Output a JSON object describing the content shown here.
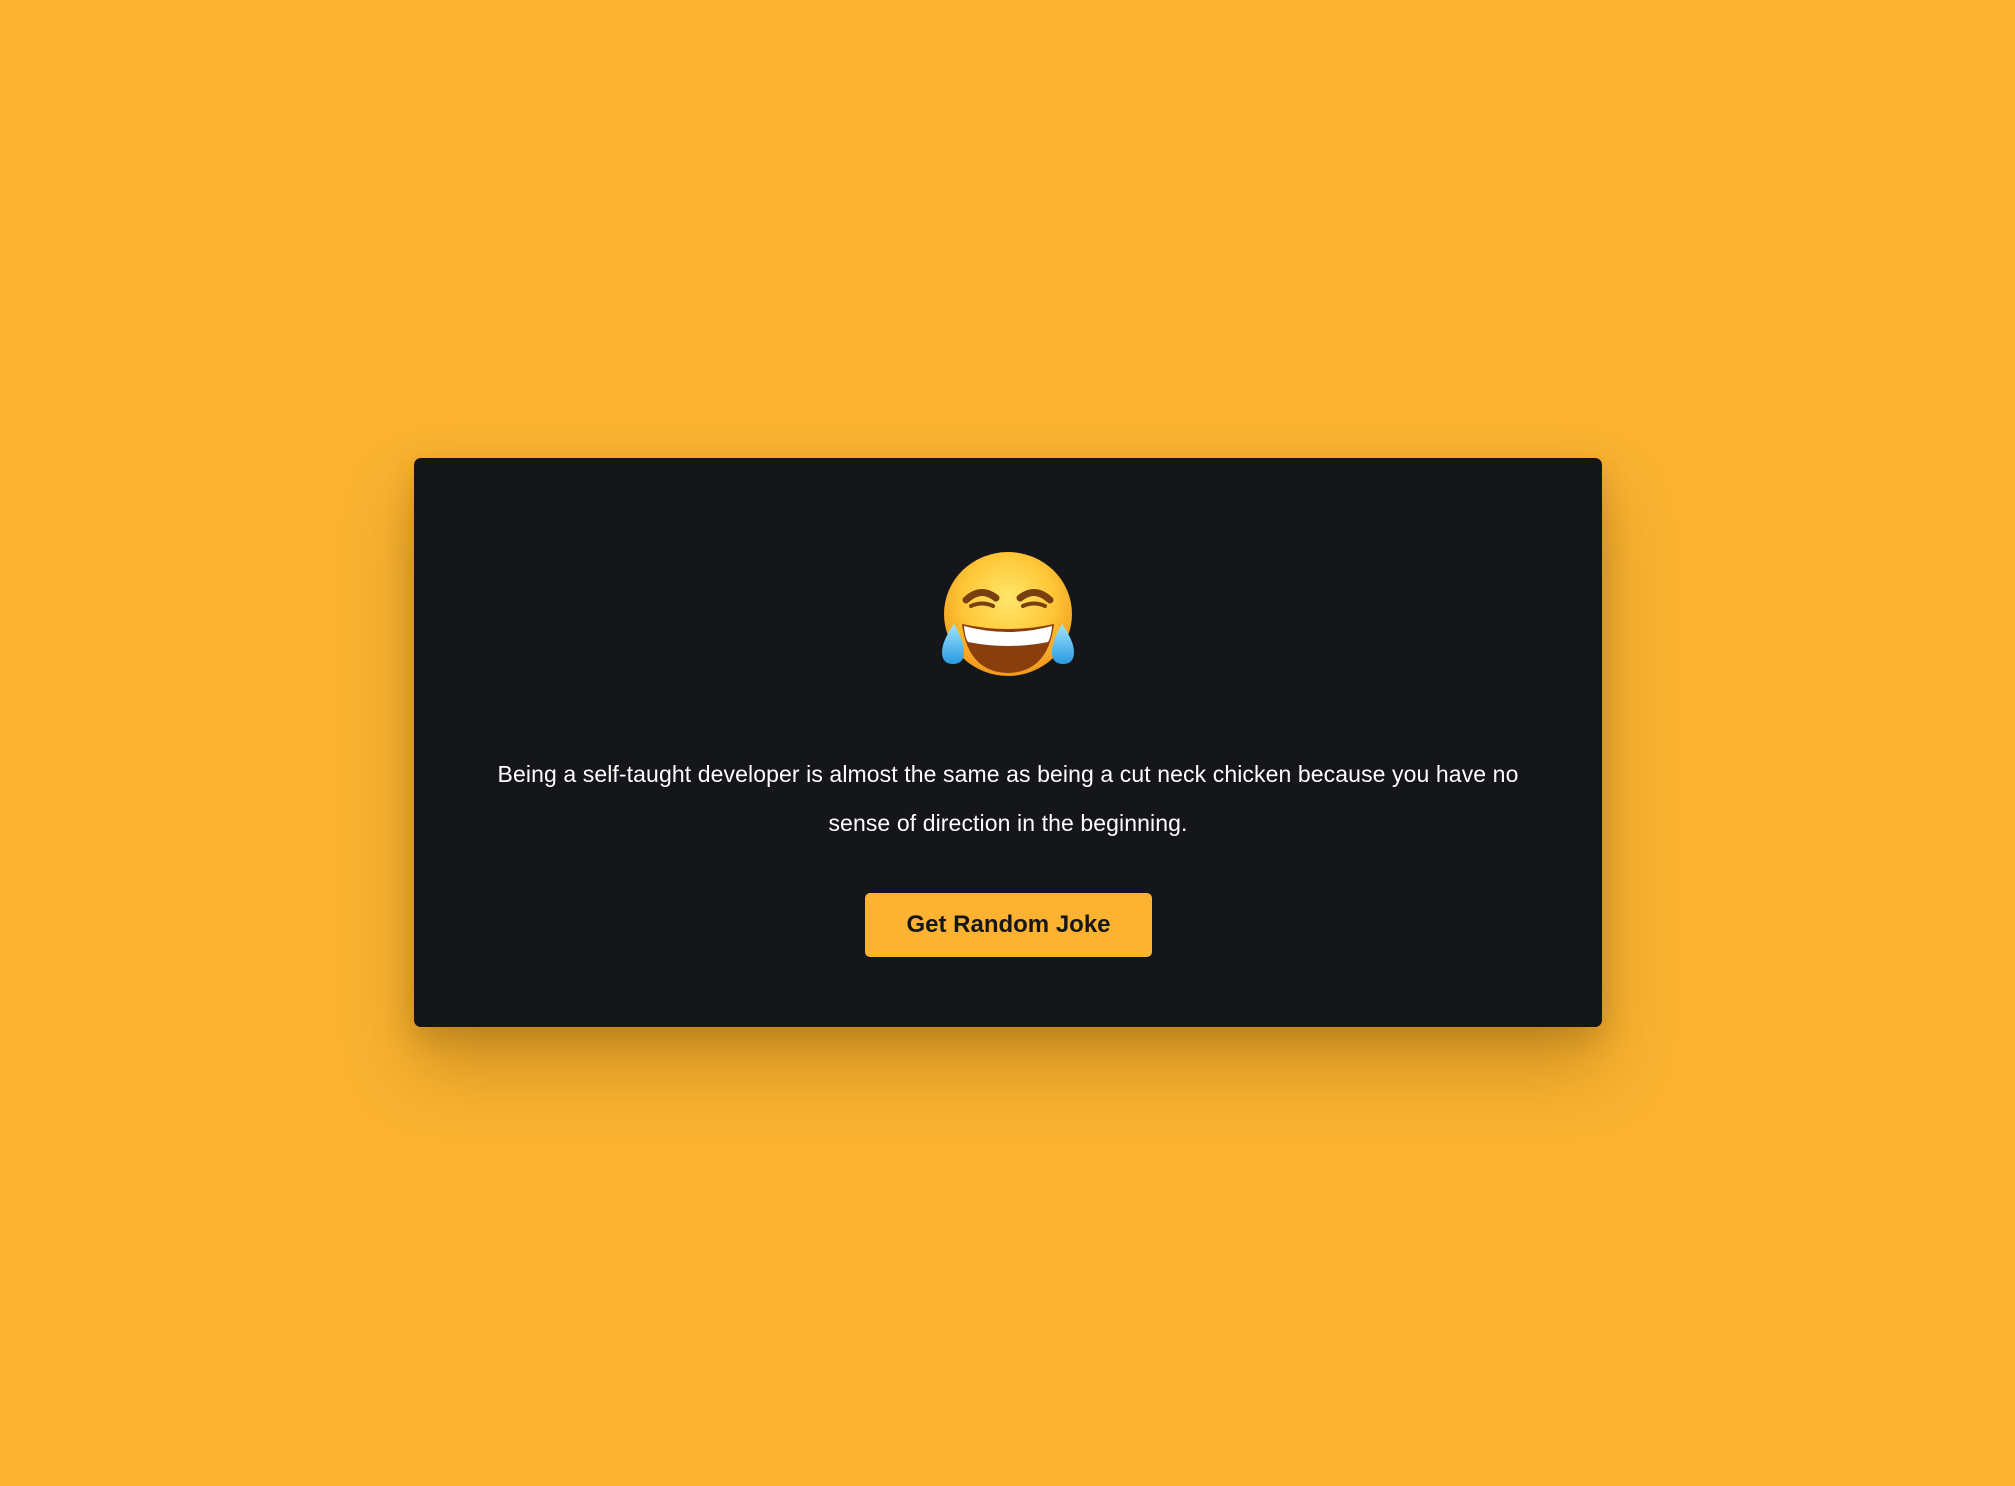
{
  "card": {
    "emoji_icon": "face-with-tears-of-joy-icon",
    "joke_text": "Being a self-taught developer is almost the same as being a cut neck chicken because you have no sense of direction in the beginning.",
    "button_label": "Get Random Joke"
  },
  "colors": {
    "background": "#FBB331",
    "card": "#15161A",
    "button": "#FBB331",
    "text": "#FFFFFF"
  }
}
